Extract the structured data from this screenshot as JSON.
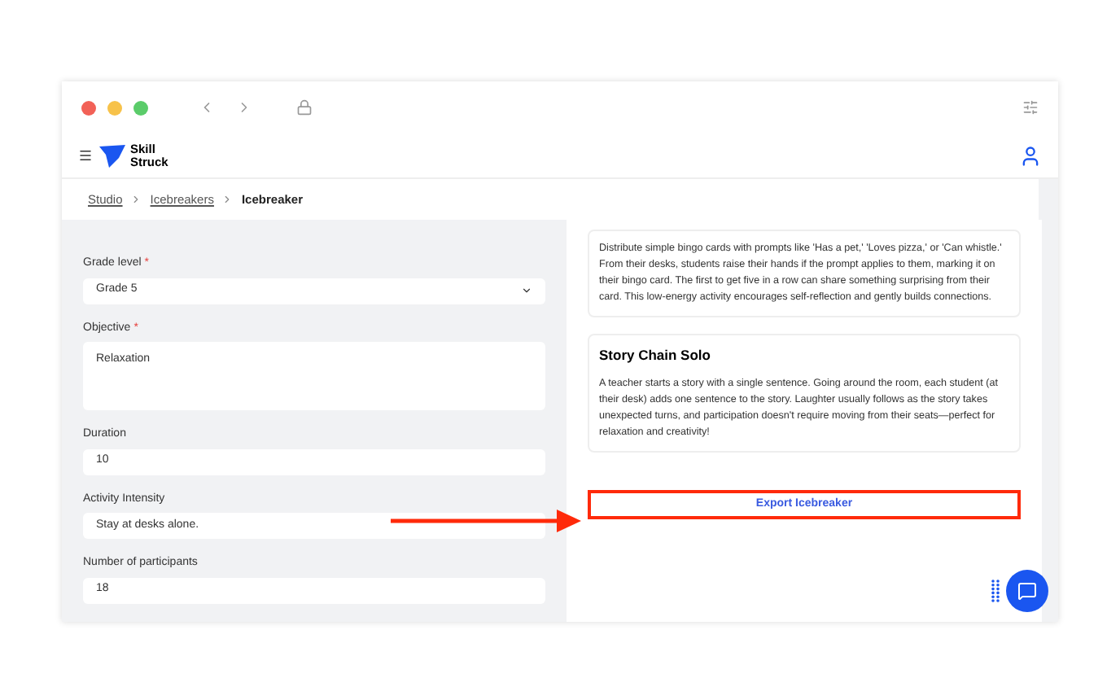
{
  "header": {
    "logo": "Skill Struck"
  },
  "breadcrumb": [
    {
      "label": "Studio",
      "link": true
    },
    {
      "label": "Icebreakers",
      "link": true
    },
    {
      "label": "Icebreaker",
      "link": false
    }
  ],
  "form": [
    {
      "kind": "select",
      "label": "Grade level",
      "required_mark": "*",
      "value": "Grade 5"
    },
    {
      "kind": "textarea",
      "label": "Objective",
      "required_mark": "*",
      "value": "Relaxation"
    },
    {
      "kind": "input",
      "label": "Duration",
      "value": "10"
    },
    {
      "kind": "input",
      "label": "Activity Intensity",
      "value": "Stay at desks alone."
    },
    {
      "kind": "input",
      "label": "Number of participants",
      "value": "18"
    }
  ],
  "cards": [
    {
      "text": "Distribute simple bingo cards with prompts like 'Has a pet,' 'Loves pizza,' or 'Can whistle.' From their desks, students raise their hands if the prompt applies to them, marking it on their bingo card. The first to get five in a row can share something surprising from their card. This low-energy activity encourages self-reflection and gently builds connections."
    },
    {
      "title": "Story Chain Solo",
      "text": "A teacher starts a story with a single sentence. Going around the room, each student (at their desk) adds one sentence to the story. Laughter usually follows as the story takes unexpected turns, and participation doesn't require moving from their seats—perfect for relaxation and creativity!"
    }
  ],
  "export_button": "Export Icebreaker"
}
